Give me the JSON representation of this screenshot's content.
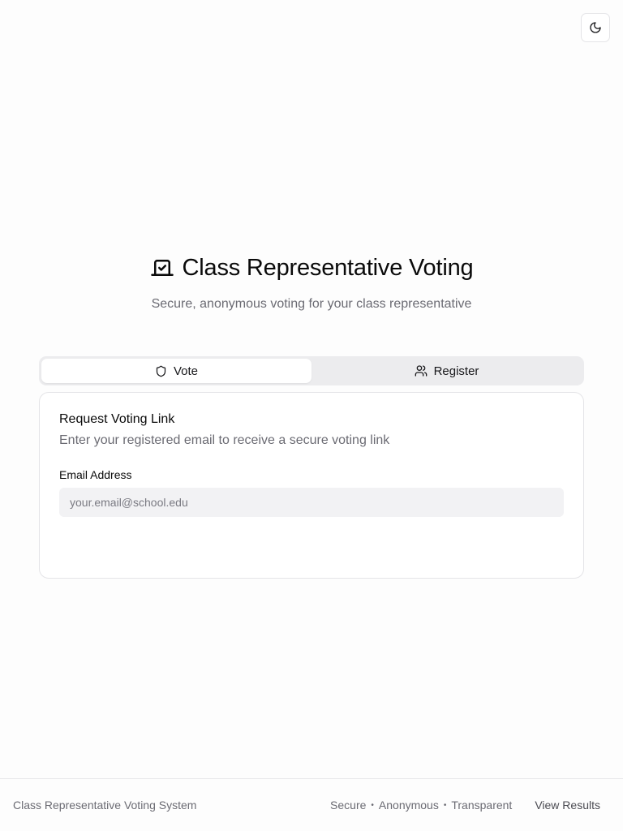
{
  "theme_toggle": {
    "icon": "moon-icon"
  },
  "hero": {
    "title": "Class Representative Voting",
    "subtitle": "Secure, anonymous voting for your class representative",
    "icon": "vote-ballot-icon"
  },
  "tabs": [
    {
      "label": "Vote",
      "icon": "shield-icon",
      "active": true
    },
    {
      "label": "Register",
      "icon": "users-icon",
      "active": false
    }
  ],
  "card": {
    "title": "Request Voting Link",
    "description": "Enter your registered email to receive a secure voting link",
    "email_label": "Email Address",
    "email_placeholder": "your.email@school.edu",
    "email_value": ""
  },
  "footer": {
    "system_name": "Class Representative Voting System",
    "tagline": [
      "Secure",
      "Anonymous",
      "Transparent"
    ],
    "view_results": "View Results"
  }
}
